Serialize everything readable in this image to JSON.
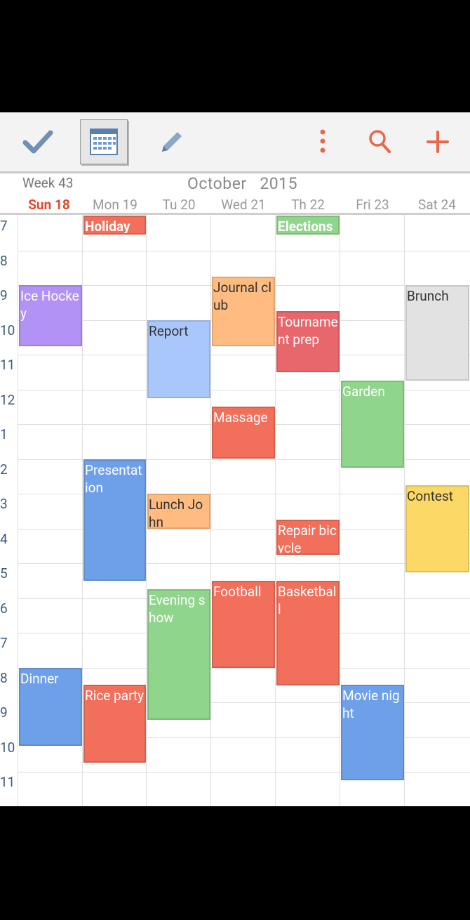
{
  "toolbar": {
    "buttons": [
      {
        "name": "tasks-button",
        "icon": "checkmark-icon"
      },
      {
        "name": "calendar-view-button",
        "icon": "calendar-grid-icon"
      },
      {
        "name": "edit-button",
        "icon": "pencil-icon"
      },
      {
        "name": "overflow-menu-button",
        "icon": "vertical-dots-icon"
      },
      {
        "name": "search-button",
        "icon": "search-icon"
      },
      {
        "name": "add-event-button",
        "icon": "plus-icon"
      }
    ],
    "accent": "#e8674a"
  },
  "header": {
    "week": "Week 43",
    "month": "October",
    "year": "2015",
    "days": [
      "Sun 18",
      "Mon 19",
      "Tu 20",
      "Wed 21",
      "Th 22",
      "Fri 23",
      "Sat 24"
    ],
    "today_color": "#e24a2e"
  },
  "hours": [
    "7",
    "8",
    "9",
    "10",
    "11",
    "12",
    "1",
    "2",
    "3",
    "4",
    "5",
    "6",
    "7",
    "8",
    "9",
    "10",
    "11"
  ],
  "events": [
    {
      "title": "Holiday",
      "day": 1,
      "start": 7.0,
      "end": 7.55,
      "color": "#f26f5b",
      "text": "light",
      "bold": true
    },
    {
      "title": "Elections",
      "day": 4,
      "start": 7.0,
      "end": 7.55,
      "color": "#8fd58b",
      "text": "light",
      "bold": true
    },
    {
      "title": "Ice Hockey",
      "day": 0,
      "start": 9.0,
      "end": 10.75,
      "color": "#b292f4",
      "text": "light"
    },
    {
      "title": "Journal club",
      "day": 3,
      "start": 8.75,
      "end": 10.75,
      "color": "#ffbb80",
      "text": "dark"
    },
    {
      "title": "Brunch",
      "day": 6,
      "start": 9.0,
      "end": 11.75,
      "color": "#e2e2e2",
      "text": "dark"
    },
    {
      "title": "Report",
      "day": 2,
      "start": 10.0,
      "end": 12.25,
      "color": "#aac7fb",
      "text": "dark"
    },
    {
      "title": "Tournament prep",
      "day": 4,
      "start": 9.75,
      "end": 11.5,
      "color": "#e7676c",
      "text": "light"
    },
    {
      "title": "Garden",
      "day": 5,
      "start": 11.75,
      "end": 14.25,
      "color": "#8fd58b",
      "text": "light"
    },
    {
      "title": "Massage",
      "day": 3,
      "start": 12.5,
      "end": 14.0,
      "color": "#f26f5b",
      "text": "light"
    },
    {
      "title": "Presentation",
      "day": 1,
      "start": 14.0,
      "end": 17.5,
      "color": "#6ea0ea",
      "text": "light"
    },
    {
      "title": "Contest",
      "day": 6,
      "start": 14.75,
      "end": 17.25,
      "color": "#fcd966",
      "text": "dark"
    },
    {
      "title": "Lunch John",
      "day": 2,
      "start": 15.0,
      "end": 16.0,
      "color": "#ffbb80",
      "text": "dark"
    },
    {
      "title": "Repair bicycle",
      "day": 4,
      "start": 15.75,
      "end": 16.75,
      "color": "#f26f5b",
      "text": "light"
    },
    {
      "title": "Evening show",
      "day": 2,
      "start": 17.75,
      "end": 21.5,
      "color": "#8fd58b",
      "text": "light"
    },
    {
      "title": "Football",
      "day": 3,
      "start": 17.5,
      "end": 20.0,
      "color": "#f26f5b",
      "text": "light"
    },
    {
      "title": "Basketball",
      "day": 4,
      "start": 17.5,
      "end": 20.5,
      "color": "#f26f5b",
      "text": "light"
    },
    {
      "title": "Dinner",
      "day": 0,
      "start": 20.0,
      "end": 22.25,
      "color": "#6ea0ea",
      "text": "light"
    },
    {
      "title": "Rice party",
      "day": 1,
      "start": 20.5,
      "end": 22.75,
      "color": "#f26f5b",
      "text": "light"
    },
    {
      "title": "Movie night",
      "day": 5,
      "start": 20.5,
      "end": 23.25,
      "color": "#6ea0ea",
      "text": "light"
    }
  ]
}
